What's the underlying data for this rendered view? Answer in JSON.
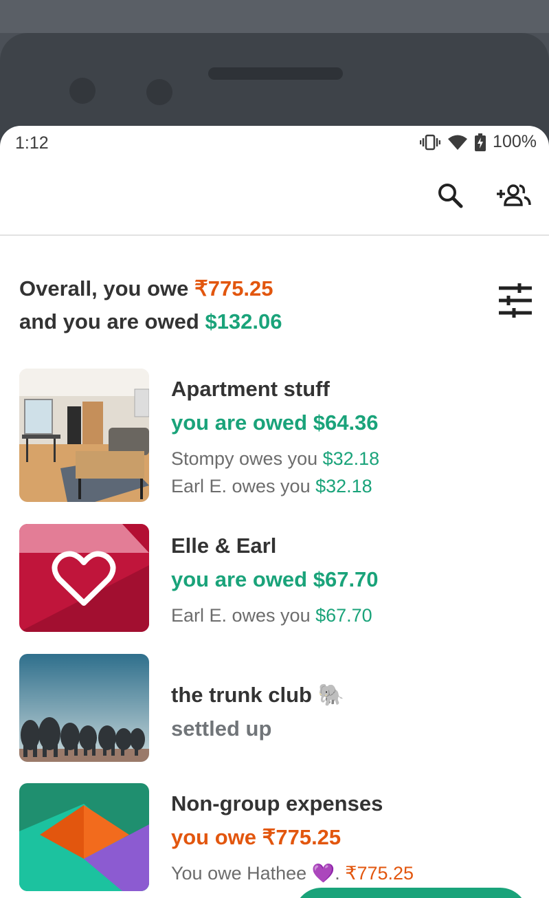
{
  "status_bar": {
    "time": "1:12",
    "battery": "100%"
  },
  "summary": {
    "owe_prefix": "Overall, you owe ",
    "owe_amount": "₹775.25",
    "owed_prefix": "and you are owed ",
    "owed_amount": "$132.06"
  },
  "groups": [
    {
      "name": "Apartment stuff",
      "status": "you are owed $64.36",
      "lines": [
        {
          "text": "Stompy owes you ",
          "amount": "$32.18"
        },
        {
          "text": "Earl E. owes you ",
          "amount": "$32.18"
        }
      ]
    },
    {
      "name": "Elle & Earl",
      "status": "you are owed $67.70",
      "lines": [
        {
          "text": "Earl E. owes you ",
          "amount": "$67.70"
        }
      ]
    },
    {
      "name": "the trunk club 🐘",
      "status": "settled up",
      "lines": []
    },
    {
      "name": "Non-group expenses",
      "status": "you owe ₹775.25",
      "lines": [
        {
          "text": "You owe Hathee 💜. ",
          "amount": "₹775.25"
        }
      ]
    }
  ],
  "colors": {
    "green": "#1aa37a",
    "orange": "#e2560e",
    "text": "#333333"
  },
  "icons": [
    "search-icon",
    "add-group-icon",
    "filter-icon",
    "vibrate-icon",
    "wifi-icon",
    "battery-icon"
  ]
}
